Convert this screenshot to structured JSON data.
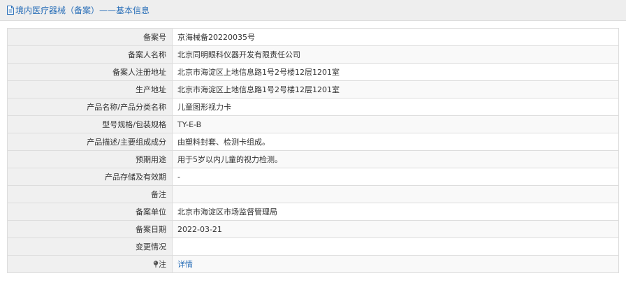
{
  "header": {
    "title": "境内医疗器械（备案）——基本信息"
  },
  "rows": [
    {
      "label": "备案号",
      "value": "京海械备20220035号"
    },
    {
      "label": "备案人名称",
      "value": "北京同明眼科仪器开发有限责任公司"
    },
    {
      "label": "备案人注册地址",
      "value": "北京市海淀区上地信息路1号2号楼12层1201室"
    },
    {
      "label": "生产地址",
      "value": "北京市海淀区上地信息路1号2号楼12层1201室"
    },
    {
      "label": "产品名称/产品分类名称",
      "value": "儿童图形视力卡"
    },
    {
      "label": "型号规格/包装规格",
      "value": "TY-E-B"
    },
    {
      "label": "产品描述/主要组成成分",
      "value": "由塑料封套、检测卡组成。"
    },
    {
      "label": "预期用途",
      "value": "用于5岁以内儿童的视力检测。"
    },
    {
      "label": "产品存储及有效期",
      "value": "-"
    },
    {
      "label": "备注",
      "value": ""
    },
    {
      "label": "备案单位",
      "value": "北京市海淀区市场监督管理局"
    },
    {
      "label": "备案日期",
      "value": "2022-03-21"
    },
    {
      "label": "变更情况",
      "value": ""
    }
  ],
  "note_row": {
    "label": "注",
    "link": "详情",
    "icon": "pin-icon"
  },
  "colors": {
    "link": "#2a6fb8",
    "label_bg": "#f0f0f0",
    "border": "#dddddd",
    "title_bg": "#eeeeee"
  }
}
